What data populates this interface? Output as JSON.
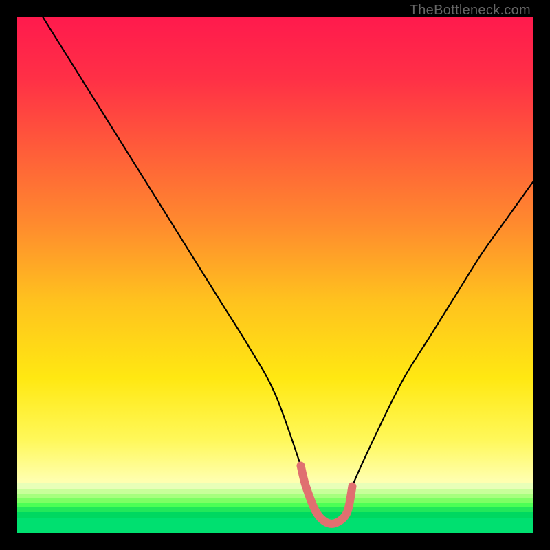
{
  "watermark": "TheBottleneck.com",
  "chart_data": {
    "type": "line",
    "title": "",
    "xlabel": "",
    "ylabel": "",
    "xlim": [
      0,
      100
    ],
    "ylim": [
      0,
      100
    ],
    "series": [
      {
        "name": "bottleneck-curve",
        "x": [
          5,
          10,
          15,
          20,
          25,
          30,
          35,
          40,
          45,
          50,
          55,
          56,
          58,
          60,
          62,
          64,
          65,
          70,
          75,
          80,
          85,
          90,
          95,
          100
        ],
        "y": [
          100,
          92,
          84,
          76,
          68,
          60,
          52,
          44,
          36,
          27,
          13,
          9,
          4,
          2,
          2,
          4,
          9,
          20,
          30,
          38,
          46,
          54,
          61,
          68
        ]
      }
    ],
    "highlight": {
      "name": "minimum-region",
      "x": [
        55,
        56,
        58,
        60,
        62,
        64,
        65
      ],
      "y": [
        13,
        9,
        4,
        2,
        2,
        4,
        9
      ],
      "color": "#e07070"
    },
    "background_gradient": {
      "stops": [
        {
          "pos": 0.0,
          "color": "#ff1a4d"
        },
        {
          "pos": 0.12,
          "color": "#ff3046"
        },
        {
          "pos": 0.25,
          "color": "#ff5a3a"
        },
        {
          "pos": 0.4,
          "color": "#ff8a2e"
        },
        {
          "pos": 0.55,
          "color": "#ffc21e"
        },
        {
          "pos": 0.7,
          "color": "#ffe812"
        },
        {
          "pos": 0.82,
          "color": "#fff85a"
        },
        {
          "pos": 0.9,
          "color": "#ffffb0"
        }
      ]
    },
    "green_bands": [
      {
        "top_pct": 90.2,
        "h_pct": 1.2,
        "color": "#e8ffb8"
      },
      {
        "top_pct": 91.4,
        "h_pct": 1.0,
        "color": "#c8ff9a"
      },
      {
        "top_pct": 92.4,
        "h_pct": 0.9,
        "color": "#a6ff7e"
      },
      {
        "top_pct": 93.3,
        "h_pct": 0.9,
        "color": "#7dff64"
      },
      {
        "top_pct": 94.2,
        "h_pct": 0.9,
        "color": "#4cff55"
      },
      {
        "top_pct": 95.1,
        "h_pct": 0.9,
        "color": "#22e85a"
      },
      {
        "top_pct": 96.0,
        "h_pct": 1.0,
        "color": "#00d860"
      },
      {
        "top_pct": 97.0,
        "h_pct": 3.0,
        "color": "#00e070"
      }
    ]
  }
}
